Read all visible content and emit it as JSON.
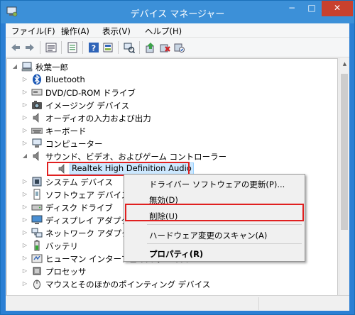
{
  "window": {
    "title": "デバイス マネージャー",
    "min": "−",
    "max": "□",
    "close": "✕"
  },
  "menu": [
    "ファイル(F)",
    "操作(A)",
    "表示(V)",
    "ヘルプ(H)"
  ],
  "toolbar": [
    "back-icon",
    "forward-icon",
    "properties-view-icon",
    "list-view-icon",
    "help-icon",
    "show-hidden-icon",
    "scan-hardware-icon",
    "update-driver-icon",
    "uninstall-icon",
    "enable-device-icon"
  ],
  "tree": {
    "root": "秋葉一郎",
    "items": [
      {
        "label": "Bluetooth",
        "icon": "bluetooth-icon"
      },
      {
        "label": "DVD/CD-ROM ドライブ",
        "icon": "dvd-icon"
      },
      {
        "label": "イメージング デバイス",
        "icon": "camera-icon"
      },
      {
        "label": "オーディオの入力および出力",
        "icon": "speaker-icon"
      },
      {
        "label": "キーボード",
        "icon": "keyboard-icon"
      },
      {
        "label": "コンピューター",
        "icon": "computer-icon"
      },
      {
        "label": "サウンド、ビデオ、およびゲーム コントローラー",
        "icon": "speaker-icon"
      },
      {
        "label": "Realtek High Definition Audio",
        "icon": "speaker-icon"
      },
      {
        "label": "システム デバイス",
        "icon": "system-icon"
      },
      {
        "label": "ソフトウェア デバイス",
        "icon": "software-device-icon"
      },
      {
        "label": "ディスク ドライブ",
        "icon": "disk-icon"
      },
      {
        "label": "ディスプレイ アダプター",
        "icon": "display-icon"
      },
      {
        "label": "ネットワーク アダプター",
        "icon": "network-icon"
      },
      {
        "label": "バッテリ",
        "icon": "battery-icon"
      },
      {
        "label": "ヒューマン インターフェイス デバイス",
        "icon": "hid-icon"
      },
      {
        "label": "プロセッサ",
        "icon": "processor-icon"
      },
      {
        "label": "マウスとそのほかのポインティング デバイス",
        "icon": "mouse-icon"
      }
    ]
  },
  "context_menu": {
    "update_driver": "ドライバー ソフトウェアの更新(P)...",
    "disable": "無効(D)",
    "uninstall": "削除(U)",
    "scan": "ハードウェア変更のスキャン(A)",
    "properties": "プロパティ(R)"
  },
  "colors": {
    "title_bar": "#3c90d8",
    "close": "#c8412e",
    "highlight": "#e02020",
    "selection": "#cde8ff"
  }
}
